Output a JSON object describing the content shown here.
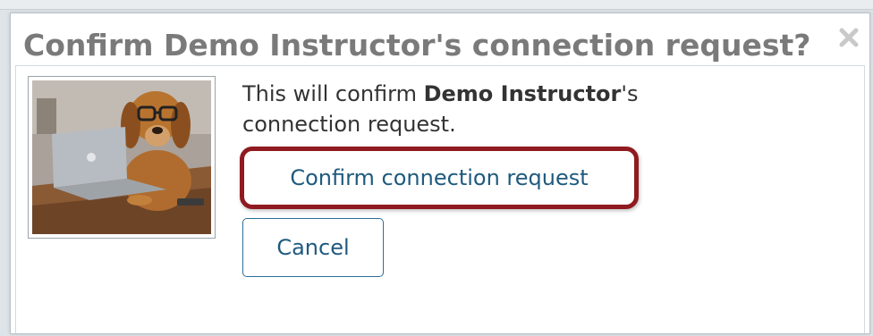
{
  "dialog": {
    "title": "Confirm Demo Instructor's connection request?",
    "close_icon": "close-x-icon",
    "avatar_alt": "dog-with-glasses-at-laptop",
    "message_prefix": "This will confirm ",
    "message_name": "Demo Instructor",
    "message_suffix": "'s connection request.",
    "confirm_label": "Confirm connection request",
    "cancel_label": "Cancel"
  },
  "colors": {
    "title": "#7a7a7a",
    "button_text": "#1f5a7e",
    "button_border": "#2c6e96",
    "highlight": "#8f1a1f"
  }
}
